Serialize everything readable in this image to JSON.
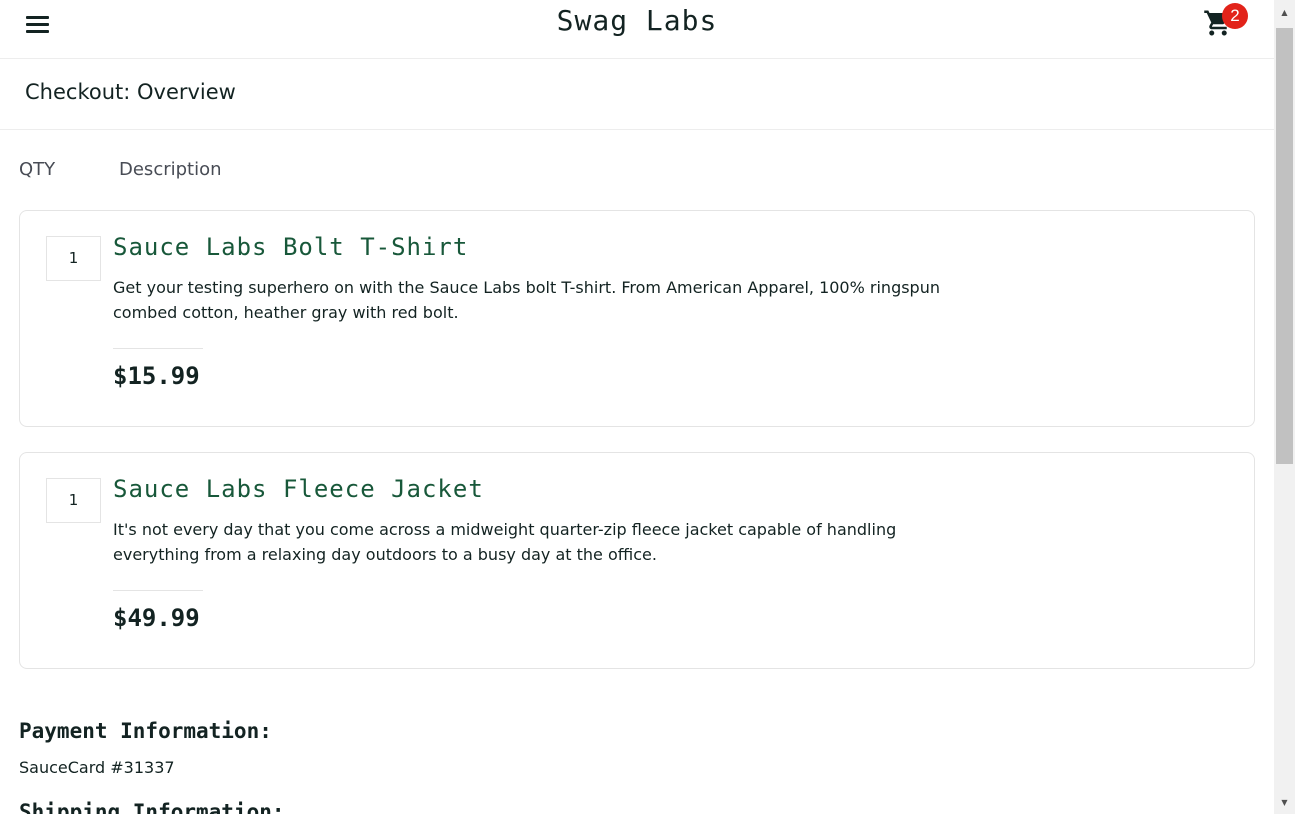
{
  "header": {
    "app_logo": "Swag Labs",
    "cart_badge_count": "2",
    "menu_icon": "hamburger-menu-icon",
    "cart_icon": "shopping-cart-icon"
  },
  "page": {
    "title": "Checkout: Overview"
  },
  "columns": {
    "qty": "QTY",
    "description": "Description"
  },
  "items": [
    {
      "quantity": "1",
      "name": "Sauce Labs Bolt T-Shirt",
      "description": "Get your testing superhero on with the Sauce Labs bolt T-shirt. From American Apparel, 100% ringspun combed cotton, heather gray with red bolt.",
      "price": "$15.99"
    },
    {
      "quantity": "1",
      "name": "Sauce Labs Fleece Jacket",
      "description": "It's not every day that you come across a midweight quarter-zip fleece jacket capable of handling everything from a relaxing day outdoors to a busy day at the office.",
      "price": "$49.99"
    }
  ],
  "summary": {
    "payment_label": "Payment Information:",
    "payment_value": "SauceCard #31337",
    "shipping_label": "Shipping Information:"
  },
  "colors": {
    "item_name": "#18583a",
    "badge": "#e2231a",
    "text": "#132322"
  }
}
